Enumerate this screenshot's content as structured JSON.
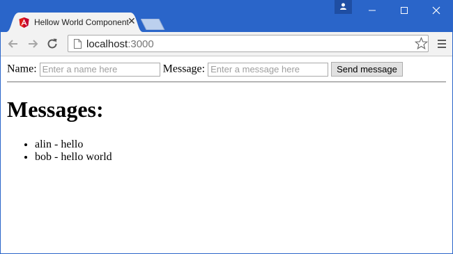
{
  "browser": {
    "tab_title": "Hellow World Component",
    "url_host": "localhost",
    "url_port": ":3000",
    "accent": "#2a65c9"
  },
  "form": {
    "name_label": "Name:",
    "name_placeholder": "Enter a name here",
    "name_value": "",
    "message_label": "Message:",
    "message_placeholder": "Enter a message here",
    "message_value": "",
    "send_label": "Send message"
  },
  "messages": {
    "heading": "Messages:",
    "items": [
      {
        "text": "alin - hello"
      },
      {
        "text": "bob - hello world"
      }
    ]
  },
  "icons": [
    "angular-icon",
    "tab-close-icon",
    "profile-icon",
    "minimize-icon",
    "maximize-icon",
    "close-window-icon",
    "back-icon",
    "forward-icon",
    "reload-icon",
    "page-icon",
    "star-icon",
    "menu-icon"
  ]
}
